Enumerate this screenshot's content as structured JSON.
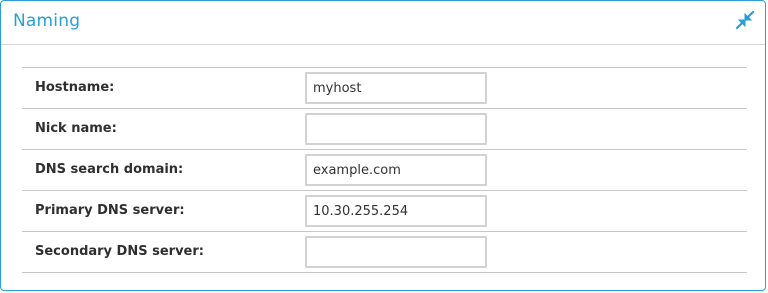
{
  "panel": {
    "title": "Naming",
    "collapse_icon": "collapse-arrows-icon",
    "accent_color": "#2a9fd6"
  },
  "fields": [
    {
      "label": "Hostname:",
      "value": "myhost"
    },
    {
      "label": "Nick name:",
      "value": ""
    },
    {
      "label": "DNS search domain:",
      "value": "example.com"
    },
    {
      "label": "Primary DNS server:",
      "value": "10.30.255.254"
    },
    {
      "label": "Secondary DNS server:",
      "value": ""
    }
  ]
}
